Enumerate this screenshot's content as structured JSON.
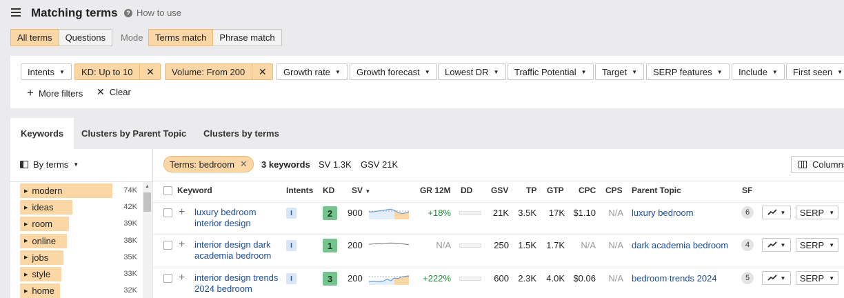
{
  "header": {
    "title": "Matching terms",
    "how_to": "How to use",
    "question_glyph": "?"
  },
  "term_type_tabs": [
    {
      "label": "All terms",
      "active": true
    },
    {
      "label": "Questions",
      "active": false
    }
  ],
  "mode": {
    "label": "Mode",
    "options": [
      {
        "label": "Terms match",
        "active": true
      },
      {
        "label": "Phrase match",
        "active": false
      }
    ]
  },
  "filters": {
    "intents": "Intents",
    "kd": "KD: Up to 10",
    "volume": "Volume: From 200",
    "growth_rate": "Growth rate",
    "growth_forecast": "Growth forecast",
    "lowest_dr": "Lowest DR",
    "traffic_potential": "Traffic Potential",
    "target": "Target",
    "serp_features": "SERP features",
    "include": "Include",
    "first_seen": "First seen",
    "more_filters": "More filters",
    "clear": "Clear",
    "caret": "▼",
    "remove_glyph": "✕",
    "plus_glyph": "+"
  },
  "view_tabs": [
    {
      "label": "Keywords",
      "selected": true
    },
    {
      "label": "Clusters by Parent Topic",
      "selected": false
    },
    {
      "label": "Clusters by terms",
      "selected": false
    }
  ],
  "sidebar": {
    "group_by": "By terms",
    "caret": "▼",
    "terms": [
      {
        "label": "modern",
        "count": "74K",
        "share": 1.0
      },
      {
        "label": "ideas",
        "count": "42K",
        "share": 0.57
      },
      {
        "label": "room",
        "count": "39K",
        "share": 0.53
      },
      {
        "label": "online",
        "count": "38K",
        "share": 0.51
      },
      {
        "label": "jobs",
        "count": "35K",
        "share": 0.47
      },
      {
        "label": "style",
        "count": "33K",
        "share": 0.45
      },
      {
        "label": "home",
        "count": "32K",
        "share": 0.43
      }
    ]
  },
  "summary": {
    "chip": "Terms: bedroom",
    "chip_x": "✕",
    "keywords": "3 keywords",
    "sv": "SV 1.3K",
    "gsv": "GSV 21K",
    "columns": "Columns"
  },
  "table": {
    "headers": {
      "keyword": "Keyword",
      "intents": "Intents",
      "kd": "KD",
      "sv": "SV",
      "sv_sort": "▼",
      "gr": "GR 12M",
      "dd": "DD",
      "gsv": "GSV",
      "tp": "TP",
      "gtp": "GTP",
      "cpc": "CPC",
      "cps": "CPS",
      "parent_topic": "Parent Topic",
      "sf": "SF"
    },
    "serp_label": "SERP",
    "caret": "▼",
    "rows": [
      {
        "keyword_l1": "luxury bedroom",
        "keyword_l2": "interior design",
        "intent": "I",
        "kd": "2",
        "sv": "900",
        "gr": "+18%",
        "gsv": "21K",
        "tp": "3.5K",
        "gtp": "17K",
        "cpc": "$1.10",
        "cps": "N/A",
        "parent_topic": "luxury bedroom",
        "sf": "6",
        "trend": [
          0.45,
          0.45,
          0.4,
          0.35,
          0.3,
          0.25,
          0.2,
          0.3,
          0.5,
          0.6,
          0.55,
          0.45
        ],
        "forecast": true
      },
      {
        "keyword_l1": "interior design dark",
        "keyword_l2": "academia bedroom",
        "intent": "I",
        "kd": "1",
        "sv": "200",
        "gr": "N/A",
        "gsv": "250",
        "tp": "1.5K",
        "gtp": "1.7K",
        "cpc": "N/A",
        "cps": "N/A",
        "parent_topic": "dark academia bedroom",
        "sf": "4",
        "trend": [
          0.45,
          0.42,
          0.4,
          0.38,
          0.36,
          0.35,
          0.34,
          0.35,
          0.37,
          0.4,
          0.44,
          0.48
        ],
        "forecast": false
      },
      {
        "keyword_l1": "interior design trends",
        "keyword_l2": "2024 bedroom",
        "intent": "I",
        "kd": "3",
        "sv": "200",
        "gr": "+222%",
        "gsv": "600",
        "tp": "2.3K",
        "gtp": "4.0K",
        "cpc": "$0.06",
        "cps": "N/A",
        "parent_topic": "bedroom trends 2024",
        "sf": "5",
        "trend": [
          0.82,
          0.82,
          0.8,
          0.82,
          0.78,
          0.6,
          0.75,
          0.5,
          0.55,
          0.4,
          0.35,
          0.3
        ],
        "forecast": true
      }
    ]
  },
  "colors": {
    "accent": "#fcd7a6",
    "link": "#1d4ea0",
    "kd_green": "#76c38f",
    "positive": "#1f8a3a",
    "spark": "#6a9fd8"
  },
  "icons": [
    "menu-icon",
    "question-icon",
    "plus-icon",
    "close-icon",
    "chevron-down-icon",
    "sidebar-layout-icon",
    "columns-icon",
    "trend-chart-icon"
  ]
}
